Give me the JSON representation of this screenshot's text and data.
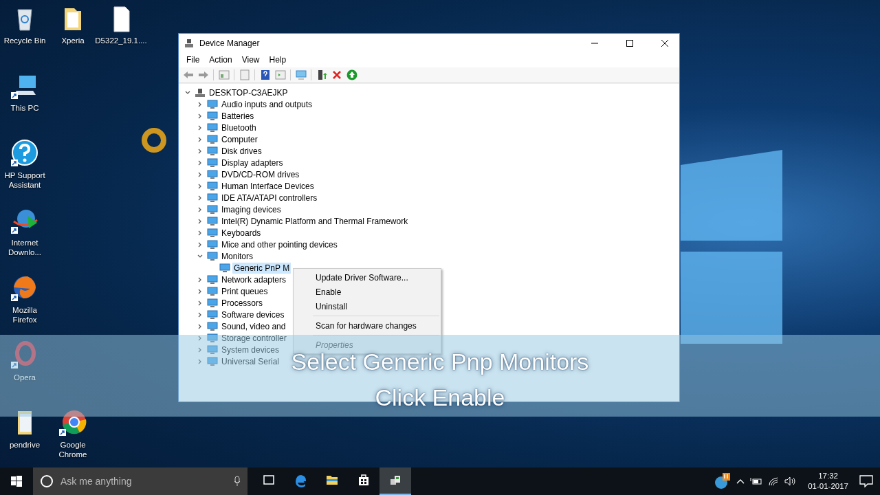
{
  "desktop_icons": [
    {
      "kind": "recycle-bin",
      "label": "Recycle Bin"
    },
    {
      "kind": "folder",
      "label": "Xperia"
    },
    {
      "kind": "file",
      "label": "D5322_19.1...."
    },
    {
      "kind": "computer",
      "label": "This PC"
    },
    {
      "kind": "help",
      "label": "HP Support Assistant"
    },
    {
      "kind": "download",
      "label": "Internet Downlo..."
    },
    {
      "kind": "fox",
      "label": "Mozilla Firefox"
    },
    {
      "kind": "ring",
      "label": "Opera"
    },
    {
      "kind": "document",
      "label": "pendrive"
    },
    {
      "kind": "chrome",
      "label": "Google Chrome"
    }
  ],
  "window": {
    "title": "Device Manager",
    "menu": [
      "File",
      "Action",
      "View",
      "Help"
    ],
    "tree": {
      "label": "DESKTOP-C3AEJKP",
      "expanded": true,
      "selected": false,
      "children": [
        {
          "label": "Audio inputs and outputs",
          "expanded": false,
          "selected": false
        },
        {
          "label": "Batteries",
          "expanded": false,
          "selected": false
        },
        {
          "label": "Bluetooth",
          "expanded": false,
          "selected": false
        },
        {
          "label": "Computer",
          "expanded": false,
          "selected": false
        },
        {
          "label": "Disk drives",
          "expanded": false,
          "selected": false
        },
        {
          "label": "Display adapters",
          "expanded": false,
          "selected": false
        },
        {
          "label": "DVD/CD-ROM drives",
          "expanded": false,
          "selected": false
        },
        {
          "label": "Human Interface Devices",
          "expanded": false,
          "selected": false
        },
        {
          "label": "IDE ATA/ATAPI controllers",
          "expanded": false,
          "selected": false
        },
        {
          "label": "Imaging devices",
          "expanded": false,
          "selected": false
        },
        {
          "label": "Intel(R) Dynamic Platform and Thermal Framework",
          "expanded": false,
          "selected": false
        },
        {
          "label": "Keyboards",
          "expanded": false,
          "selected": false
        },
        {
          "label": "Mice and other pointing devices",
          "expanded": false,
          "selected": false
        },
        {
          "label": "Monitors",
          "expanded": true,
          "selected": false,
          "children": [
            {
              "label": "Generic PnP M",
              "selected": true
            }
          ]
        },
        {
          "label": "Network adapters",
          "expanded": false,
          "selected": false
        },
        {
          "label": "Print queues",
          "expanded": false,
          "selected": false
        },
        {
          "label": "Processors",
          "expanded": false,
          "selected": false
        },
        {
          "label": "Software devices",
          "expanded": false,
          "selected": false
        },
        {
          "label": "Sound, video and",
          "expanded": false,
          "selected": false
        },
        {
          "label": "Storage controller",
          "expanded": false,
          "selected": false
        },
        {
          "label": "System devices",
          "expanded": false,
          "selected": false
        },
        {
          "label": "Universal Serial",
          "expanded": false,
          "selected": false
        }
      ]
    },
    "context_menu": [
      {
        "kind": "item",
        "label": "Update Driver Software...",
        "disabled": false
      },
      {
        "kind": "item",
        "label": "Enable",
        "disabled": false
      },
      {
        "kind": "item",
        "label": "Uninstall",
        "disabled": false
      },
      {
        "kind": "separator"
      },
      {
        "kind": "item",
        "label": "Scan for hardware changes",
        "disabled": false
      },
      {
        "kind": "separator"
      },
      {
        "kind": "item",
        "label": "Properties",
        "disabled": true
      }
    ]
  },
  "caption": [
    "Select Generic Pnp Monitors",
    "Click Enable"
  ],
  "taskbar": {
    "search": {
      "placeholder": "Ask me anything"
    },
    "apps": [
      {
        "kind": "task-view",
        "active": false
      },
      {
        "kind": "edge",
        "active": false
      },
      {
        "kind": "explorer",
        "active": false
      },
      {
        "kind": "store",
        "active": false
      },
      {
        "kind": "device-manager",
        "active": true
      }
    ],
    "time": "17:32",
    "date": "01-01-2017"
  }
}
